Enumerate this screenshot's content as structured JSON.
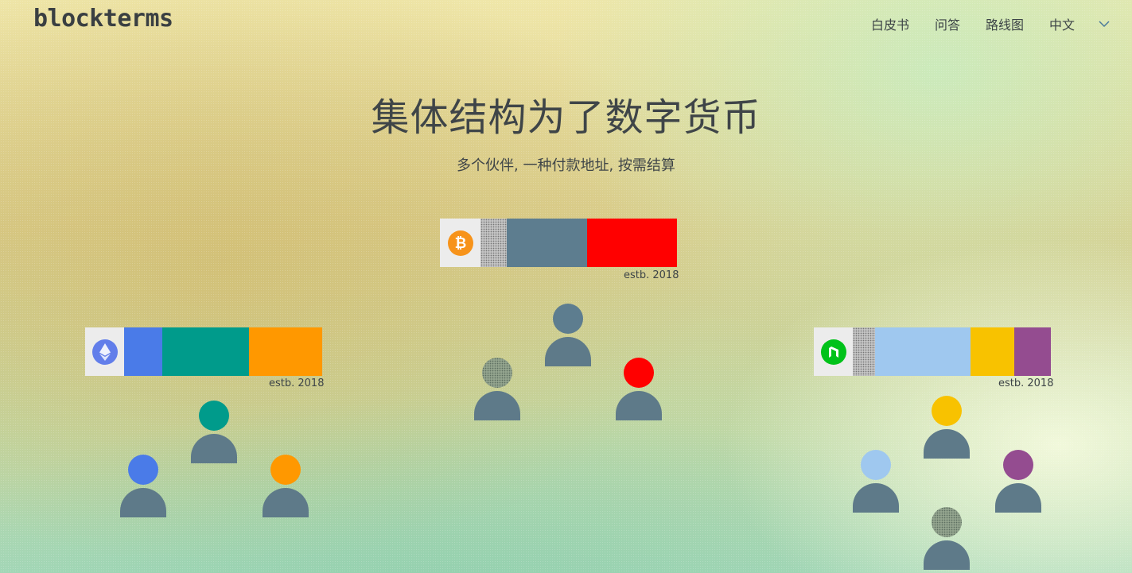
{
  "header": {
    "logo": "blockterms",
    "nav": [
      "白皮书",
      "问答",
      "路线图",
      "中文"
    ]
  },
  "hero": {
    "title": "集体结构为了数字货币",
    "subtitle": "多个伙伴, 一种付款地址, 按需结算"
  },
  "groups": [
    {
      "coin_icon": "bitcoin-icon",
      "estb": "estb. 2018",
      "segments": [
        {
          "color": "#ececec",
          "share": 0.17,
          "kind": "logo"
        },
        {
          "color": "hatch",
          "share": 0.11
        },
        {
          "color": "#5d7d8f",
          "share": 0.34
        },
        {
          "color": "#ff0000",
          "share": 0.38
        }
      ],
      "members": [
        "hatch",
        "#5d7d8f",
        "#ff0000"
      ]
    },
    {
      "coin_icon": "ethereum-icon",
      "estb": "estb. 2018",
      "segments": [
        {
          "color": "#ececec",
          "share": 0.165,
          "kind": "logo"
        },
        {
          "color": "#4a7be8",
          "share": 0.16
        },
        {
          "color": "#009b8b",
          "share": 0.365
        },
        {
          "color": "#ff9800",
          "share": 0.31
        }
      ],
      "members": [
        "#4a7be8",
        "#009b8b",
        "#ff9800"
      ]
    },
    {
      "coin_icon": "neo-icon",
      "estb": "estb. 2018",
      "segments": [
        {
          "color": "#ececec",
          "share": 0.165,
          "kind": "logo"
        },
        {
          "color": "hatch",
          "share": 0.095
        },
        {
          "color": "#9fc8ef",
          "share": 0.4
        },
        {
          "color": "#f8c200",
          "share": 0.185
        },
        {
          "color": "#944c90",
          "share": 0.155
        }
      ],
      "members": [
        "#f8c200",
        "#9fc8ef",
        "#944c90",
        "hatch"
      ]
    }
  ]
}
